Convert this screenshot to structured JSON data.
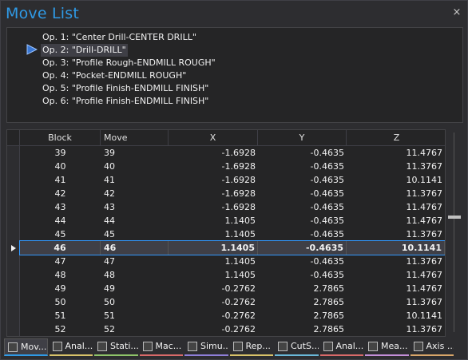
{
  "window": {
    "title": "Move List",
    "close_glyph": "×"
  },
  "operations": [
    {
      "label": "Op. 1: \"Center Drill-CENTER DRILL\""
    },
    {
      "label": "Op. 2: \"Drill-DRILL\""
    },
    {
      "label": "Op. 3: \"Profile Rough-ENDMILL ROUGH\""
    },
    {
      "label": "Op. 4: \"Pocket-ENDMILL ROUGH\""
    },
    {
      "label": "Op. 5: \"Profile Finish-ENDMILL FINISH\""
    },
    {
      "label": "Op. 6: \"Profile Finish-ENDMILL FINISH\""
    }
  ],
  "selected_operation": 2,
  "table": {
    "headers": {
      "block": "Block",
      "move": "Move",
      "x": "X",
      "y": "Y",
      "z": "Z"
    },
    "rows": [
      {
        "block": "39",
        "move": "39",
        "x": "-1.6928",
        "y": "-0.4635",
        "z": "11.4767"
      },
      {
        "block": "40",
        "move": "40",
        "x": "-1.6928",
        "y": "-0.4635",
        "z": "11.3767"
      },
      {
        "block": "41",
        "move": "41",
        "x": "-1.6928",
        "y": "-0.4635",
        "z": "10.1141"
      },
      {
        "block": "42",
        "move": "42",
        "x": "-1.6928",
        "y": "-0.4635",
        "z": "11.3767"
      },
      {
        "block": "43",
        "move": "43",
        "x": "-1.6928",
        "y": "-0.4635",
        "z": "11.4767"
      },
      {
        "block": "44",
        "move": "44",
        "x": "1.1405",
        "y": "-0.4635",
        "z": "11.4767"
      },
      {
        "block": "45",
        "move": "45",
        "x": "1.1405",
        "y": "-0.4635",
        "z": "11.3767"
      },
      {
        "block": "46",
        "move": "46",
        "x": "1.1405",
        "y": "-0.4635",
        "z": "10.1141"
      },
      {
        "block": "47",
        "move": "47",
        "x": "1.1405",
        "y": "-0.4635",
        "z": "11.3767"
      },
      {
        "block": "48",
        "move": "48",
        "x": "1.1405",
        "y": "-0.4635",
        "z": "11.4767"
      },
      {
        "block": "49",
        "move": "49",
        "x": "-0.2762",
        "y": "2.7865",
        "z": "11.4767"
      },
      {
        "block": "50",
        "move": "50",
        "x": "-0.2762",
        "y": "2.7865",
        "z": "11.3767"
      },
      {
        "block": "51",
        "move": "51",
        "x": "-0.2762",
        "y": "2.7865",
        "z": "10.1141"
      },
      {
        "block": "52",
        "move": "52",
        "x": "-0.2762",
        "y": "2.7865",
        "z": "11.3767"
      }
    ],
    "current_block": "46"
  },
  "tabs": [
    {
      "label": "Mov...",
      "icon": "move-list-icon",
      "color": "#2f9ae6"
    },
    {
      "label": "Anal...",
      "icon": "analysis-icon",
      "color": "#d9c36a"
    },
    {
      "label": "Stati...",
      "icon": "statistics-icon",
      "color": "#8fc46a"
    },
    {
      "label": "Mac...",
      "icon": "machine-icon",
      "color": "#d96a6a"
    },
    {
      "label": "Simu...",
      "icon": "simulation-icon",
      "color": "#8f7fd9"
    },
    {
      "label": "Rep...",
      "icon": "report-icon",
      "color": "#d9c36a"
    },
    {
      "label": "CutS...",
      "icon": "cut-stock-icon",
      "color": "#6ab8d9"
    },
    {
      "label": "Anal...",
      "icon": "analysis-icon",
      "color": "#d96a6a"
    },
    {
      "label": "Mea...",
      "icon": "measure-icon",
      "color": "#c48fd9"
    },
    {
      "label": "Axis ...",
      "icon": "axis-icon",
      "color": "#d9a66a"
    }
  ]
}
